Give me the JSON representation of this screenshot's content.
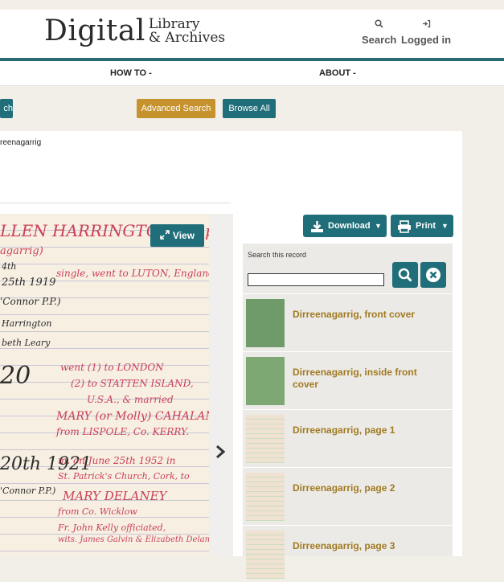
{
  "header": {
    "logo_word": "Digital",
    "logo_line1": "Library",
    "logo_line2": "& Archives",
    "search_label": "Search",
    "login_label": "Logged in"
  },
  "nav": {
    "howto": "HOW TO -",
    "about": "ABOUT -"
  },
  "toolbar": {
    "search_partial": "ch",
    "advanced_search": "Advanced Search",
    "browse_all": "Browse All"
  },
  "breadcrumb": "reenagarrig",
  "viewer": {
    "view_label": "View",
    "card_lines": [
      {
        "text": "LLEN HARRINGTON (Lapy) Lanla",
        "color": "red"
      },
      {
        "text": "agarrig)",
        "color": "red"
      },
      {
        "text": "4th",
        "color": "blk"
      },
      {
        "text": "25th 1919",
        "color": "blk"
      },
      {
        "text": "single, went to LUTON, England.",
        "color": "red"
      },
      {
        "text": "'Connor P.P.)",
        "color": "blk"
      },
      {
        "text": "Harrington",
        "color": "blk"
      },
      {
        "text": "beth Leary",
        "color": "blk"
      },
      {
        "text": "20",
        "color": "blk"
      },
      {
        "text": "went (1) to LONDON",
        "color": "red"
      },
      {
        "text": "(2) to STATTEN ISLAND,",
        "color": "red"
      },
      {
        "text": "U.S.A., & married",
        "color": "red"
      },
      {
        "text": "MARY (or Molly) CAHALANE",
        "color": "red"
      },
      {
        "text": "from LISPOLE, Co. KERRY.",
        "color": "red"
      },
      {
        "text": "20th 1921",
        "color": "blk"
      },
      {
        "text": "m. on June 25th 1952 in",
        "color": "red"
      },
      {
        "text": "St. Patrick's Church, Cork, to",
        "color": "red"
      },
      {
        "text": "'Connor P.P.)",
        "color": "blk"
      },
      {
        "text": "MARY DELANEY",
        "color": "red"
      },
      {
        "text": "from     Co. Wicklow",
        "color": "red"
      },
      {
        "text": "Fr. John Kelly officiated,",
        "color": "red"
      },
      {
        "text": "wits. James Galvin & Elizabeth Delaney",
        "color": "red"
      }
    ]
  },
  "actions": {
    "download": "Download",
    "print": "Print"
  },
  "sidebar": {
    "search_label": "Search this record",
    "search_value": "",
    "items": [
      {
        "title": "Dirreenagarrig, front cover",
        "thumb_color": "#6f9a6a"
      },
      {
        "title": "Dirreenagarrig, inside front cover",
        "thumb_color": "#7ea873"
      },
      {
        "title": "Dirreenagarrig, page 1",
        "thumb_color": "#efe2d2"
      },
      {
        "title": "Dirreenagarrig, page 2",
        "thumb_color": "#efe2d2"
      },
      {
        "title": "Dirreenagarrig, page 3",
        "thumb_color": "#efe2d2"
      }
    ]
  },
  "colors": {
    "teal": "#1f6e7a",
    "gold": "#c5922e",
    "item_title": "#a07a22"
  }
}
